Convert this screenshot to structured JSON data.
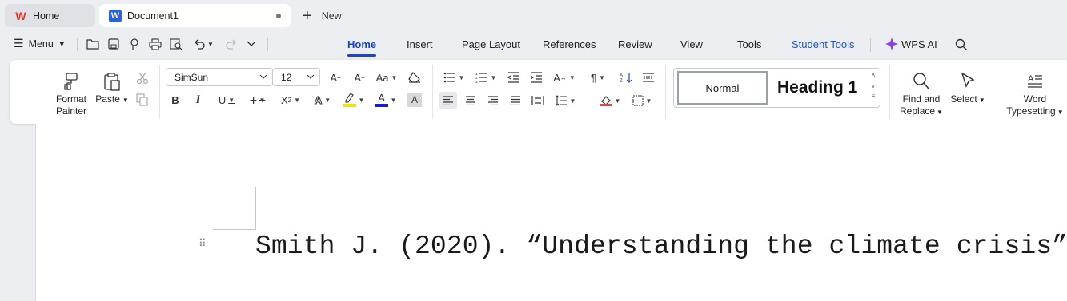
{
  "tabs": {
    "home": {
      "label": "Home"
    },
    "document": {
      "label": "Document1"
    },
    "new_label": "New"
  },
  "menu": {
    "menu_label": "Menu",
    "tabs": [
      {
        "label": "Home",
        "active": true
      },
      {
        "label": "Insert"
      },
      {
        "label": "Page Layout"
      },
      {
        "label": "References"
      },
      {
        "label": "Review"
      },
      {
        "label": "View"
      },
      {
        "label": "Tools"
      },
      {
        "label": "Student Tools"
      }
    ],
    "wps_ai_label": "WPS AI"
  },
  "ribbon": {
    "format_painter_label": "Format\nPainter",
    "format_painter_line1": "Format",
    "format_painter_line2": "Painter",
    "paste_label": "Paste",
    "font_name": "SimSun",
    "font_size": "12",
    "styles": {
      "normal": "Normal",
      "heading1": "Heading 1"
    },
    "find_replace_line1": "Find and",
    "find_replace_line2": "Replace",
    "select_label": "Select",
    "word_typesetting_line1": "Word",
    "word_typesetting_line2": "Typesetting",
    "colors": {
      "highlight": "#f5e400",
      "font_color": "#1a1adb",
      "accent": "#1a46c9"
    }
  },
  "document": {
    "text": "Smith J. (2020). “Understanding the climate crisis”"
  }
}
